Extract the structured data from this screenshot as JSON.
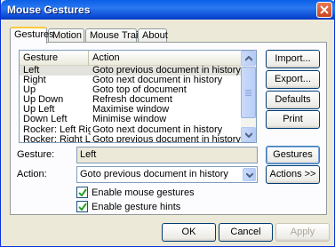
{
  "window": {
    "title": "Mouse Gestures"
  },
  "tabs": [
    {
      "label": "Gestures"
    },
    {
      "label": "Motion"
    },
    {
      "label": "Mouse Trails"
    },
    {
      "label": "About"
    }
  ],
  "list": {
    "columns": [
      "Gesture",
      "Action"
    ],
    "rows": [
      {
        "gesture": "Left",
        "action": "Goto previous document in history"
      },
      {
        "gesture": "Right",
        "action": "Goto next document in history"
      },
      {
        "gesture": "Up",
        "action": "Goto top of document"
      },
      {
        "gesture": "Up Down",
        "action": "Refresh document"
      },
      {
        "gesture": "Up Left",
        "action": "Maximise window"
      },
      {
        "gesture": "Down Left",
        "action": "Minimise window"
      },
      {
        "gesture": "Rocker: Left Right",
        "action": "Goto next document in history"
      },
      {
        "gesture": "Rocker: Right Left",
        "action": "Goto previous document in history"
      }
    ]
  },
  "side_buttons": {
    "import": "Import...",
    "export": "Export...",
    "defaults": "Defaults",
    "print": "Print"
  },
  "form": {
    "gesture_label": "Gesture:",
    "gesture_value": "Left",
    "action_label": "Action:",
    "action_value": "Goto previous document in history",
    "gestures_button": "Gestures >>",
    "actions_button": "Actions >>",
    "enable_mouse_gestures": {
      "label": "Enable mouse gestures",
      "checked": true
    },
    "enable_gesture_hints": {
      "label": "Enable gesture hints",
      "checked": true
    }
  },
  "footer": {
    "ok": "OK",
    "cancel": "Cancel",
    "apply": "Apply"
  },
  "colors": {
    "titlebar": "#0a5fe8",
    "face": "#ece9d8",
    "selected_row": "#e3e2dd"
  }
}
